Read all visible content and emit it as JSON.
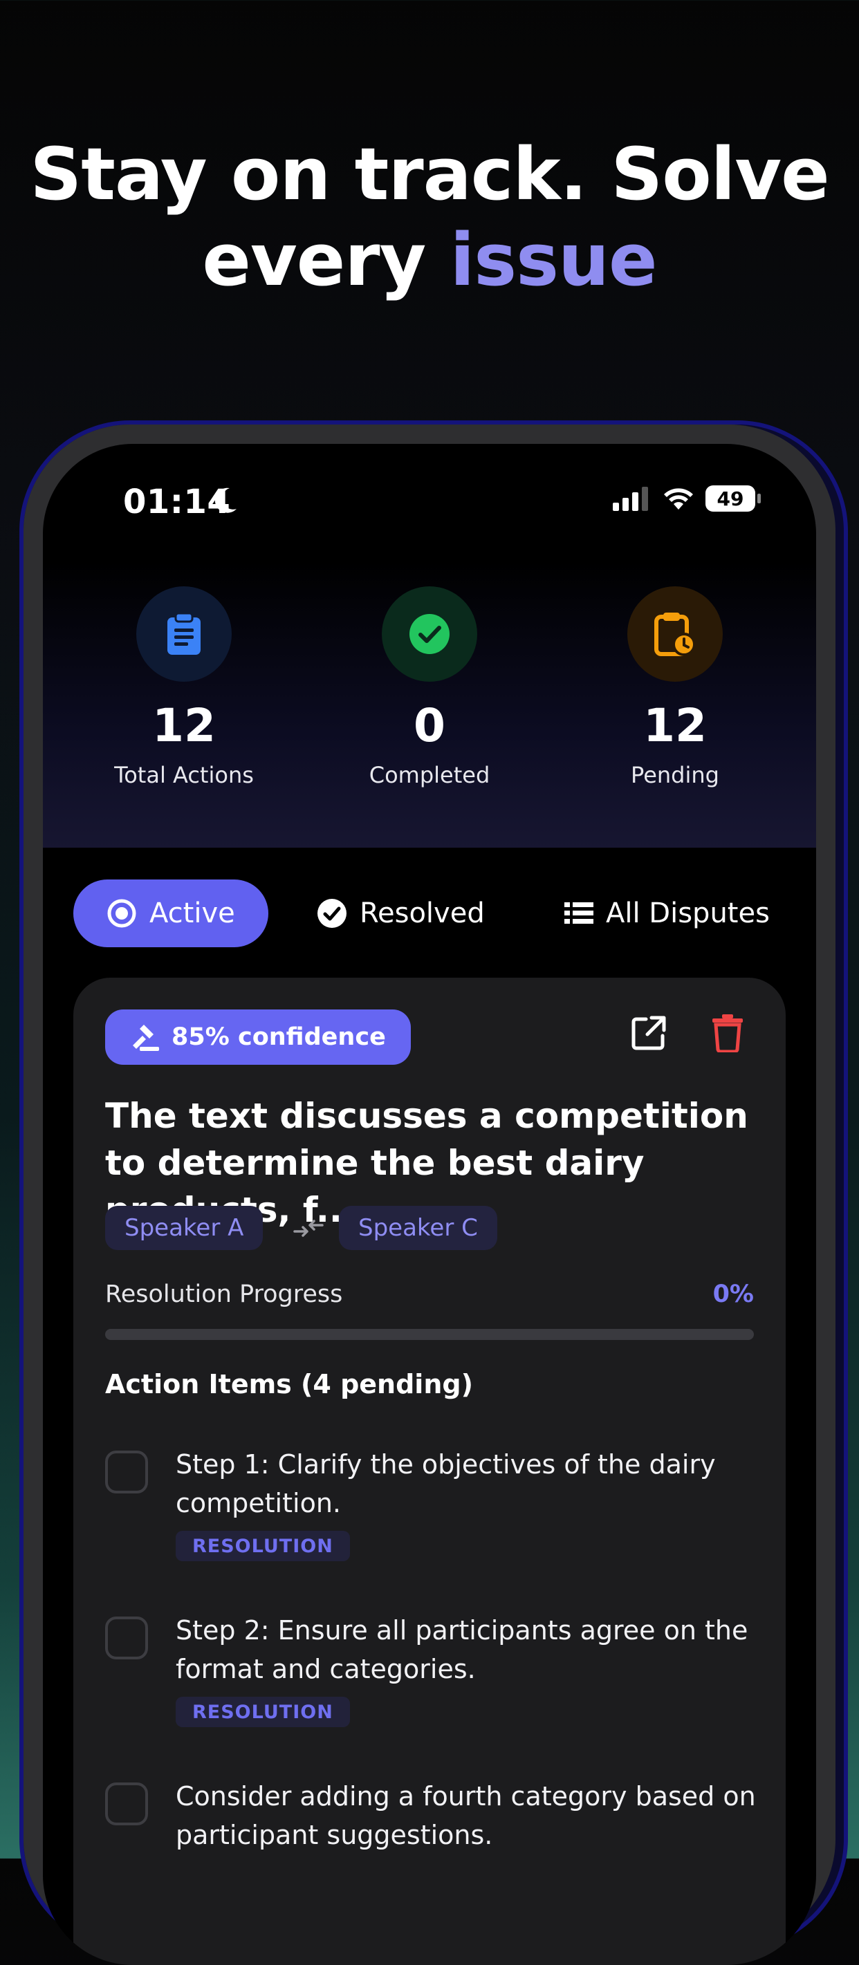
{
  "headline": {
    "line1": "Stay on track. Solve",
    "line2_prefix": "every ",
    "line2_accent": "issue"
  },
  "status_bar": {
    "time": "01:14",
    "battery": "49"
  },
  "stats": [
    {
      "value": "12",
      "label": "Total Actions",
      "color": "#3b82f6",
      "bg": "#0e1a33",
      "icon": "clipboard-icon"
    },
    {
      "value": "0",
      "label": "Completed",
      "color": "#22c55e",
      "bg": "#0a2a1c",
      "icon": "check-circle-icon"
    },
    {
      "value": "12",
      "label": "Pending",
      "color": "#f59e0b",
      "bg": "#2a1a06",
      "icon": "clipboard-clock-icon"
    }
  ],
  "tabs": [
    {
      "label": "Active",
      "icon": "radio-icon",
      "active": true
    },
    {
      "label": "Resolved",
      "icon": "check-circle-icon",
      "active": false
    },
    {
      "label": "All Disputes",
      "icon": "list-icon",
      "active": false
    }
  ],
  "card": {
    "confidence": "85% confidence",
    "title": "The text discusses a competition to determine the best dairy products, f...",
    "speakers": [
      "Speaker A",
      "Speaker C"
    ],
    "progress_label": "Resolution Progress",
    "progress_value": "0%",
    "progress_fraction": 0,
    "section_title": "Action Items (4 pending)",
    "items": [
      {
        "text": "Step 1: Clarify the objectives of the dairy competition.",
        "tag": "RESOLUTION"
      },
      {
        "text": "Step 2: Ensure all participants agree on the format and categories.",
        "tag": "RESOLUTION"
      },
      {
        "text": "Consider adding a fourth category based on participant suggestions.",
        "tag": ""
      }
    ]
  },
  "colors": {
    "accent": "#6666f2",
    "delete": "#ef4444",
    "headline_accent": "#8f8df0"
  }
}
